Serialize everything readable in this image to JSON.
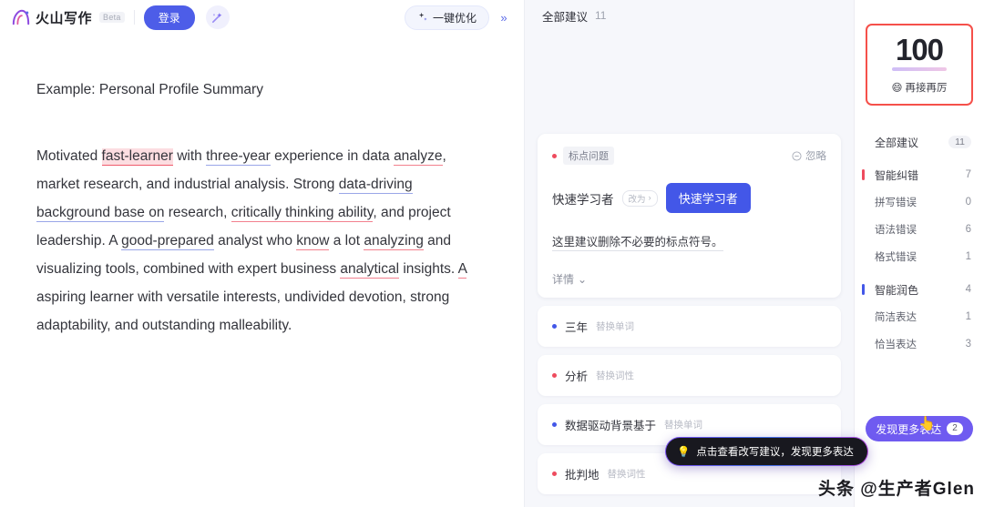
{
  "topbar": {
    "brand_name": "火山写作",
    "beta": "Beta",
    "login_label": "登录",
    "magic_icon": "magic-wand-icon",
    "optimize_label": "一键优化",
    "optimize_icon": "sparkle-icon",
    "collapse_icon": "double-chevron-right-icon"
  },
  "document": {
    "title": "Example: Personal Profile Summary",
    "paragraph_parts": [
      {
        "text": "Motivated ",
        "style": "plain"
      },
      {
        "text": "fast-learner",
        "style": "highlight-red"
      },
      {
        "text": " with ",
        "style": "plain"
      },
      {
        "text": "three-year",
        "style": "underline-blue"
      },
      {
        "text": " experience in data ",
        "style": "plain"
      },
      {
        "text": "analyze",
        "style": "underline-red"
      },
      {
        "text": ", market research, and industrial analysis. Strong ",
        "style": "plain"
      },
      {
        "text": "data-driving background base on",
        "style": "underline-blue"
      },
      {
        "text": " research, ",
        "style": "plain"
      },
      {
        "text": "critically thinking ability",
        "style": "underline-red"
      },
      {
        "text": ", and project leadership. A ",
        "style": "plain"
      },
      {
        "text": "good-prepared",
        "style": "underline-blue"
      },
      {
        "text": " analyst who ",
        "style": "plain"
      },
      {
        "text": "know",
        "style": "underline-red"
      },
      {
        "text": " a lot ",
        "style": "plain"
      },
      {
        "text": "analyzing",
        "style": "underline-red"
      },
      {
        "text": " and visualizing tools, combined with expert business ",
        "style": "plain"
      },
      {
        "text": "analytical",
        "style": "underline-red"
      },
      {
        "text": " insights. ",
        "style": "plain"
      },
      {
        "text": "A",
        "style": "underline-red"
      },
      {
        "text": " aspiring learner with versatile interests, undivided devotion, strong adaptability, and outstanding malleability.",
        "style": "plain"
      }
    ]
  },
  "suggestions_panel": {
    "header_label": "全部建议",
    "header_count": "11",
    "card": {
      "tag": "标点问题",
      "ignore_label": "忽略",
      "ignore_icon": "minus-circle-icon",
      "original": "快速学习者",
      "arrow_label": "改为",
      "replacement": "快速学习者",
      "note": "这里建议删除不必要的标点符号。",
      "more_label": "详情",
      "more_icon": "chevron-down-icon"
    },
    "items": [
      {
        "word": "三年",
        "kind": "替换单词",
        "dot": "#4357e8"
      },
      {
        "word": "分析",
        "kind": "替换词性",
        "dot": "#ee4b5e"
      },
      {
        "word": "数据驱动背景基于",
        "kind": "替换单词",
        "dot": "#4357e8"
      },
      {
        "word": "批判地",
        "kind": "替换词性",
        "dot": "#ee4b5e"
      }
    ],
    "tooltip": {
      "icon": "lightbulb-icon",
      "text": "点击查看改写建议，发现更多表达"
    }
  },
  "rail": {
    "score": "100",
    "score_emoji": "😄",
    "score_label": "再接再厉",
    "rows": [
      {
        "label": "全部建议",
        "value": "11",
        "style": "pill",
        "marker": "none"
      },
      {
        "label": "智能纠错",
        "value": "7",
        "style": "num",
        "marker": "red"
      },
      {
        "label": "拼写错误",
        "value": "0",
        "style": "num",
        "marker": "none",
        "sub": true
      },
      {
        "label": "语法错误",
        "value": "6",
        "style": "num",
        "marker": "none",
        "sub": true
      },
      {
        "label": "格式错误",
        "value": "1",
        "style": "num",
        "marker": "none",
        "sub": true
      },
      {
        "label": "智能润色",
        "value": "4",
        "style": "num",
        "marker": "blue"
      },
      {
        "label": "简洁表达",
        "value": "1",
        "style": "num",
        "marker": "none",
        "sub": true
      },
      {
        "label": "恰当表达",
        "value": "3",
        "style": "num",
        "marker": "none",
        "sub": true
      }
    ],
    "discover_label": "发现更多表达",
    "discover_badge": "2",
    "cursor_emoji": "👆"
  },
  "watermark": "头条 @生产者Glen",
  "colors": {
    "brand_blue": "#4d5de8",
    "accent_purple": "#6f5bf0",
    "error_red": "#ee4b5e",
    "score_border": "#f5504a"
  }
}
